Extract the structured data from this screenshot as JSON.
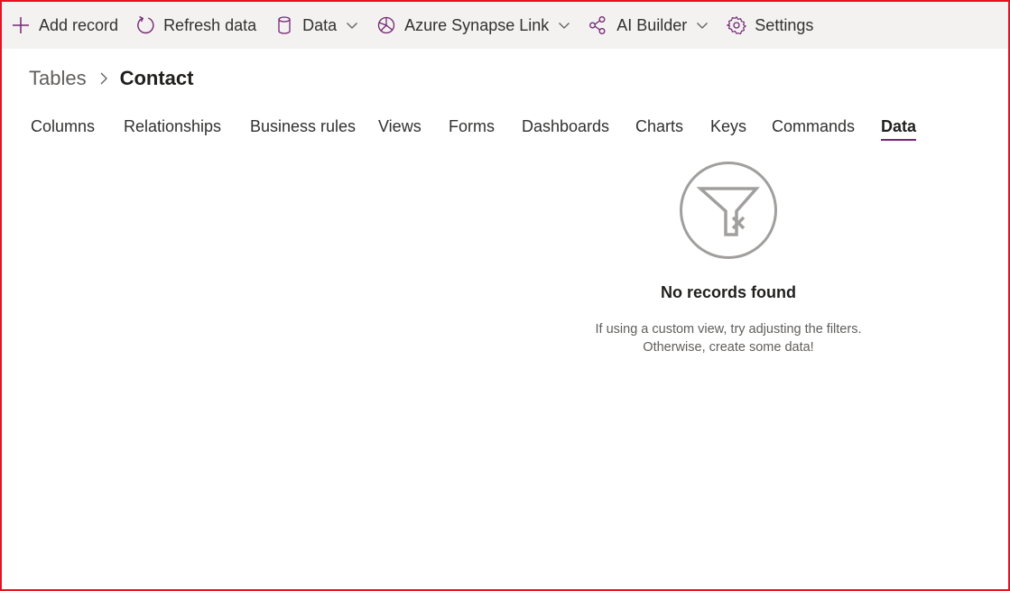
{
  "command_bar": {
    "add_record": "Add record",
    "refresh_data": "Refresh data",
    "data": "Data",
    "azure_synapse_link": "Azure Synapse Link",
    "ai_builder": "AI Builder",
    "settings": "Settings",
    "icons": {
      "add_record": "plus-icon",
      "refresh_data": "refresh-icon",
      "data": "database-icon",
      "azure_synapse_link": "synapse-icon",
      "ai_builder": "ai-builder-icon",
      "settings": "gear-icon"
    },
    "accent_color": "#742774"
  },
  "breadcrumb": {
    "root": "Tables",
    "current": "Contact"
  },
  "tabs": [
    {
      "label": "Columns",
      "active": false
    },
    {
      "label": "Relationships",
      "active": false
    },
    {
      "label": "Business rules",
      "active": false
    },
    {
      "label": "Views",
      "active": false
    },
    {
      "label": "Forms",
      "active": false
    },
    {
      "label": "Dashboards",
      "active": false
    },
    {
      "label": "Charts",
      "active": false
    },
    {
      "label": "Keys",
      "active": false
    },
    {
      "label": "Commands",
      "active": false
    },
    {
      "label": "Data",
      "active": true
    }
  ],
  "empty_state": {
    "icon": "filter-clear-icon",
    "title": "No records found",
    "line1": "If using a custom view, try adjusting the filters.",
    "line2": "Otherwise, create some data!"
  },
  "colors": {
    "active_tab_underline": "#742774",
    "frame_border": "#e81123",
    "command_bar_bg": "#f3f2f1"
  }
}
